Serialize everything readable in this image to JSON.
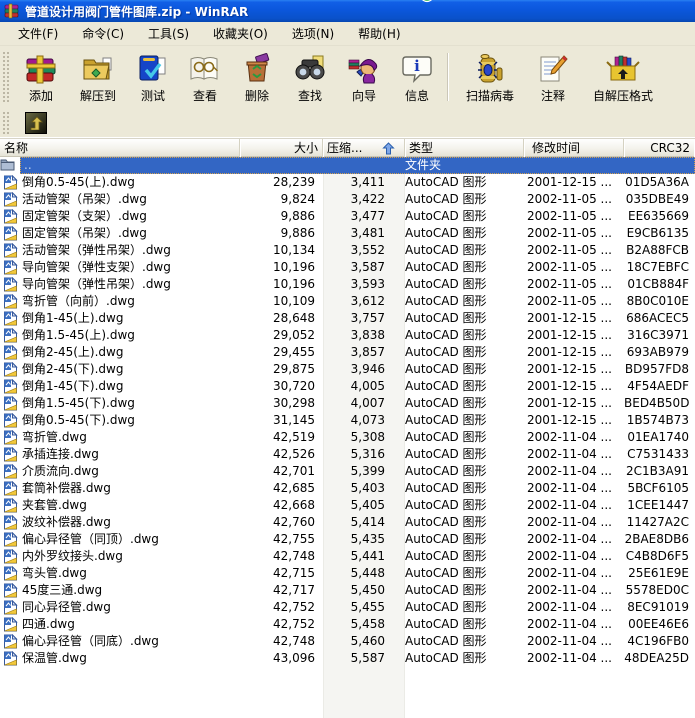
{
  "window": {
    "title": "管道设计用阀门管件图库.zip - WinRAR"
  },
  "menubar": {
    "items": [
      {
        "label": "文件(F)"
      },
      {
        "label": "命令(C)"
      },
      {
        "label": "工具(S)"
      },
      {
        "label": "收藏夹(O)"
      },
      {
        "label": "选项(N)"
      },
      {
        "label": "帮助(H)"
      }
    ]
  },
  "toolbar": {
    "buttons": [
      {
        "label": "添加"
      },
      {
        "label": "解压到"
      },
      {
        "label": "测试"
      },
      {
        "label": "查看"
      },
      {
        "label": "删除"
      },
      {
        "label": "查找"
      },
      {
        "label": "向导"
      },
      {
        "label": "信息"
      },
      {
        "label": "扫描病毒"
      },
      {
        "label": "注释"
      },
      {
        "label": "自解压格式"
      }
    ]
  },
  "list": {
    "columns": [
      {
        "label": "名称"
      },
      {
        "label": "大小"
      },
      {
        "label": "压缩..."
      },
      {
        "label": "类型"
      },
      {
        "label": "修改时间"
      },
      {
        "label": "CRC32"
      }
    ],
    "sort": {
      "column": "压缩...",
      "direction": "ascending"
    },
    "parent_row": {
      "name": "..",
      "type": "文件夹"
    },
    "file_type": "AutoCAD 图形",
    "files": [
      {
        "name": "倒角0.5-45(上).dwg",
        "size": "28,239",
        "packed": "3,411",
        "type": "AutoCAD 图形",
        "modified": "2001-12-15 ...",
        "crc": "01D5A36A"
      },
      {
        "name": "活动管架（吊架）.dwg",
        "size": "9,824",
        "packed": "3,422",
        "type": "AutoCAD 图形",
        "modified": "2002-11-05 ...",
        "crc": "035DBE49"
      },
      {
        "name": "固定管架（支架）.dwg",
        "size": "9,886",
        "packed": "3,477",
        "type": "AutoCAD 图形",
        "modified": "2002-11-05 ...",
        "crc": "EE635669"
      },
      {
        "name": "固定管架（吊架）.dwg",
        "size": "9,886",
        "packed": "3,481",
        "type": "AutoCAD 图形",
        "modified": "2002-11-05 ...",
        "crc": "E9CB6135"
      },
      {
        "name": "活动管架（弹性吊架）.dwg",
        "size": "10,134",
        "packed": "3,552",
        "type": "AutoCAD 图形",
        "modified": "2002-11-05 ...",
        "crc": "B2A88FCB"
      },
      {
        "name": "导向管架（弹性支架）.dwg",
        "size": "10,196",
        "packed": "3,587",
        "type": "AutoCAD 图形",
        "modified": "2002-11-05 ...",
        "crc": "18C7EBFC"
      },
      {
        "name": "导向管架（弹性吊架）.dwg",
        "size": "10,196",
        "packed": "3,593",
        "type": "AutoCAD 图形",
        "modified": "2002-11-05 ...",
        "crc": "01CB884F"
      },
      {
        "name": "弯折管（向前）.dwg",
        "size": "10,109",
        "packed": "3,612",
        "type": "AutoCAD 图形",
        "modified": "2002-11-05 ...",
        "crc": "8B0C010E"
      },
      {
        "name": "倒角1-45(上).dwg",
        "size": "28,648",
        "packed": "3,757",
        "type": "AutoCAD 图形",
        "modified": "2001-12-15 ...",
        "crc": "686ACEC5"
      },
      {
        "name": "倒角1.5-45(上).dwg",
        "size": "29,052",
        "packed": "3,838",
        "type": "AutoCAD 图形",
        "modified": "2001-12-15 ...",
        "crc": "316C3971"
      },
      {
        "name": "倒角2-45(上).dwg",
        "size": "29,455",
        "packed": "3,857",
        "type": "AutoCAD 图形",
        "modified": "2001-12-15 ...",
        "crc": "693AB979"
      },
      {
        "name": "倒角2-45(下).dwg",
        "size": "29,875",
        "packed": "3,946",
        "type": "AutoCAD 图形",
        "modified": "2001-12-15 ...",
        "crc": "BD957FD8"
      },
      {
        "name": "倒角1-45(下).dwg",
        "size": "30,720",
        "packed": "4,005",
        "type": "AutoCAD 图形",
        "modified": "2001-12-15 ...",
        "crc": "4F54AEDF"
      },
      {
        "name": "倒角1.5-45(下).dwg",
        "size": "30,298",
        "packed": "4,007",
        "type": "AutoCAD 图形",
        "modified": "2001-12-15 ...",
        "crc": "BED4B50D"
      },
      {
        "name": "倒角0.5-45(下).dwg",
        "size": "31,145",
        "packed": "4,073",
        "type": "AutoCAD 图形",
        "modified": "2001-12-15 ...",
        "crc": "1B574B73"
      },
      {
        "name": "弯折管.dwg",
        "size": "42,519",
        "packed": "5,308",
        "type": "AutoCAD 图形",
        "modified": "2002-11-04 ...",
        "crc": "01EA1740"
      },
      {
        "name": "承插连接.dwg",
        "size": "42,526",
        "packed": "5,316",
        "type": "AutoCAD 图形",
        "modified": "2002-11-04 ...",
        "crc": "C7531433"
      },
      {
        "name": "介质流向.dwg",
        "size": "42,701",
        "packed": "5,399",
        "type": "AutoCAD 图形",
        "modified": "2002-11-04 ...",
        "crc": "2C1B3A91"
      },
      {
        "name": "套筒补偿器.dwg",
        "size": "42,685",
        "packed": "5,403",
        "type": "AutoCAD 图形",
        "modified": "2002-11-04 ...",
        "crc": "5BCF6105"
      },
      {
        "name": "夹套管.dwg",
        "size": "42,668",
        "packed": "5,405",
        "type": "AutoCAD 图形",
        "modified": "2002-11-04 ...",
        "crc": "1CEE1447"
      },
      {
        "name": "波纹补偿器.dwg",
        "size": "42,760",
        "packed": "5,414",
        "type": "AutoCAD 图形",
        "modified": "2002-11-04 ...",
        "crc": "11427A2C"
      },
      {
        "name": "偏心异径管（同顶）.dwg",
        "size": "42,755",
        "packed": "5,435",
        "type": "AutoCAD 图形",
        "modified": "2002-11-04 ...",
        "crc": "2BAE8DB6"
      },
      {
        "name": "内外罗纹接头.dwg",
        "size": "42,748",
        "packed": "5,441",
        "type": "AutoCAD 图形",
        "modified": "2002-11-04 ...",
        "crc": "C4B8D6F5"
      },
      {
        "name": "弯头管.dwg",
        "size": "42,715",
        "packed": "5,448",
        "type": "AutoCAD 图形",
        "modified": "2002-11-04 ...",
        "crc": "25E61E9E"
      },
      {
        "name": "45度三通.dwg",
        "size": "42,717",
        "packed": "5,450",
        "type": "AutoCAD 图形",
        "modified": "2002-11-04 ...",
        "crc": "5578ED0C"
      },
      {
        "name": "同心异径管.dwg",
        "size": "42,752",
        "packed": "5,455",
        "type": "AutoCAD 图形",
        "modified": "2002-11-04 ...",
        "crc": "8EC91019"
      },
      {
        "name": "四通.dwg",
        "size": "42,752",
        "packed": "5,458",
        "type": "AutoCAD 图形",
        "modified": "2002-11-04 ...",
        "crc": "00EE46E6"
      },
      {
        "name": "偏心异径管（同底）.dwg",
        "size": "42,748",
        "packed": "5,460",
        "type": "AutoCAD 图形",
        "modified": "2002-11-04 ...",
        "crc": "4C196FB0"
      },
      {
        "name": "保温管.dwg",
        "size": "43,096",
        "packed": "5,587",
        "type": "AutoCAD 图形",
        "modified": "2002-11-04 ...",
        "crc": "48DEA25D"
      }
    ]
  },
  "colors": {
    "titlebar_blue": "#0B57DC",
    "chrome_beige": "#ECE9D8",
    "selection_blue": "#3366C4",
    "sorted_column_stripe": "#F5F5F2"
  }
}
